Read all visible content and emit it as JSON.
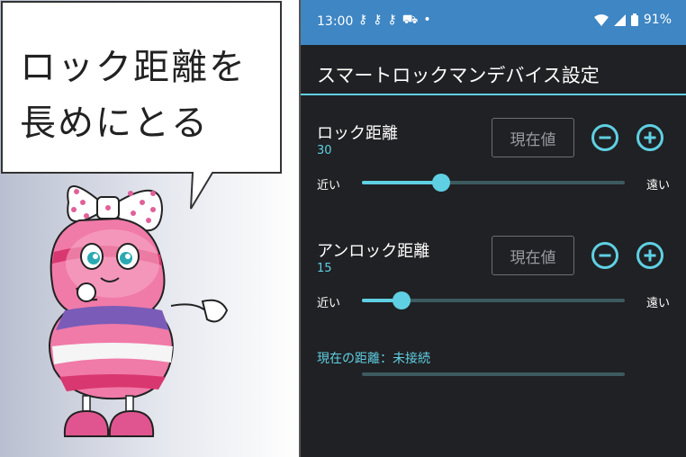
{
  "bubble": {
    "line1": "ロック距離を",
    "line2": "長めにとる"
  },
  "status_bar": {
    "time": "13:00",
    "icons": [
      "key-icon",
      "key-icon",
      "key-icon",
      "car-icon",
      "dot-icon"
    ],
    "battery": "91%"
  },
  "app": {
    "title": "スマートロックマンデバイス設定"
  },
  "lock_distance": {
    "title": "ロック距離",
    "value": "30",
    "current_button": "現在値",
    "near_label": "近い",
    "far_label": "遠い",
    "slider_fraction": 0.3
  },
  "unlock_distance": {
    "title": "アンロック距離",
    "value": "15",
    "current_button": "現在値",
    "near_label": "近い",
    "far_label": "遠い",
    "slider_fraction": 0.15
  },
  "current_distance": {
    "label": "現在の距離：未接続"
  },
  "colors": {
    "accent": "#5fd0e3",
    "status_bar": "#3e86c4",
    "background": "#202124"
  }
}
